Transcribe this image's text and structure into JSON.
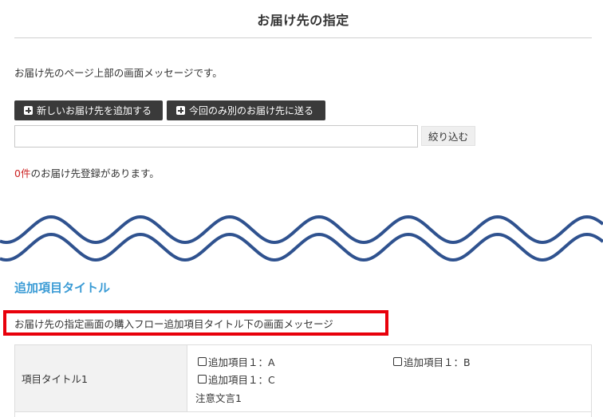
{
  "page": {
    "title": "お届け先の指定",
    "top_message": "お届け先のページ上部の画面メッセージです。"
  },
  "actions": {
    "add_address_label": "新しいお届け先を追加する",
    "one_time_address_label": "今回のみ別のお届け先に送る"
  },
  "filter": {
    "value": "",
    "placeholder": "",
    "button_label": "絞り込む"
  },
  "registered": {
    "count": "0件",
    "suffix": "のお届け先登録があります。"
  },
  "additional": {
    "section_title": "追加項目タイトル",
    "message": "お届け先の指定画面の購入フロー追加項目タイトル下の画面メッセージ",
    "rows": [
      {
        "label": "項目タイトル1",
        "options": [
          "追加項目１：A",
          "追加項目１：B",
          "追加項目１：C"
        ],
        "note": "注意文言1"
      }
    ]
  },
  "colors": {
    "button_bg": "#3a3a3a",
    "section_title": "#3a9bd5",
    "count_highlight": "#cc2222",
    "highlight_border": "#e8000b",
    "wave_stroke": "#2f528f"
  }
}
